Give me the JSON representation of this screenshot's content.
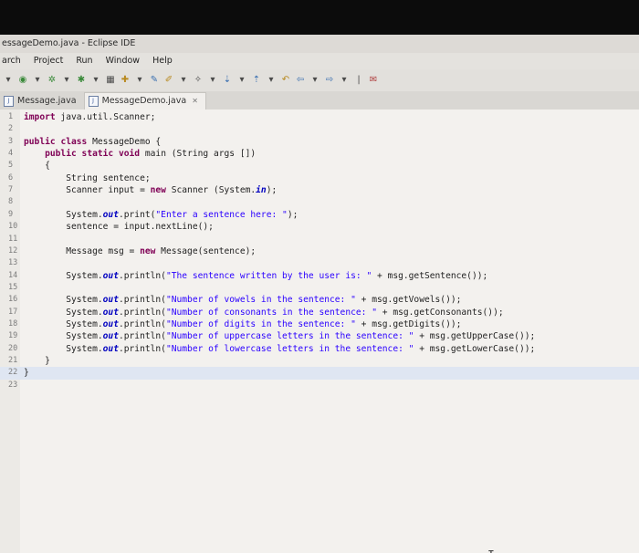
{
  "window": {
    "title": "essageDemo.java - Eclipse IDE"
  },
  "menu": {
    "items": [
      "arch",
      "Project",
      "Run",
      "Window",
      "Help"
    ]
  },
  "toolbar": {
    "icons": [
      "run-icon",
      "debug-icon",
      "coverage-icon",
      "new-icon",
      "save-icon",
      "search-icon",
      "back-icon",
      "forward-icon"
    ]
  },
  "tabs": [
    {
      "label": "Message.java",
      "active": false
    },
    {
      "label": "MessageDemo.java",
      "active": true,
      "close": "✕"
    }
  ],
  "editor": {
    "lines": [
      {
        "n": "1",
        "code": "import java.util.Scanner;"
      },
      {
        "n": "2",
        "code": ""
      },
      {
        "n": "3",
        "code": "public class MessageDemo {"
      },
      {
        "n": "4",
        "code": "    public static void main (String args [])"
      },
      {
        "n": "5",
        "code": "    {"
      },
      {
        "n": "6",
        "code": "        String sentence;"
      },
      {
        "n": "7",
        "code": "        Scanner input = new Scanner (System.in);"
      },
      {
        "n": "8",
        "code": ""
      },
      {
        "n": "9",
        "code": "        System.out.print(\"Enter a sentence here: \");"
      },
      {
        "n": "10",
        "code": "        sentence = input.nextLine();"
      },
      {
        "n": "11",
        "code": ""
      },
      {
        "n": "12",
        "code": "        Message msg = new Message(sentence);"
      },
      {
        "n": "13",
        "code": ""
      },
      {
        "n": "14",
        "code": "        System.out.println(\"The sentence written by the user is: \" + msg.getSentence());"
      },
      {
        "n": "15",
        "code": ""
      },
      {
        "n": "16",
        "code": "        System.out.println(\"Number of vowels in the sentence: \" + msg.getVowels());"
      },
      {
        "n": "17",
        "code": "        System.out.println(\"Number of consonants in the sentence: \" + msg.getConsonants());"
      },
      {
        "n": "18",
        "code": "        System.out.println(\"Number of digits in the sentence: \" + msg.getDigits());"
      },
      {
        "n": "19",
        "code": "        System.out.println(\"Number of uppercase letters in the sentence: \" + msg.getUpperCase());"
      },
      {
        "n": "20",
        "code": "        System.out.println(\"Number of lowercase letters in the sentence: \" + msg.getLowerCase());"
      },
      {
        "n": "21",
        "code": "    }"
      },
      {
        "n": "22",
        "code": "}"
      },
      {
        "n": "23",
        "code": ""
      }
    ],
    "current_line": "22"
  },
  "colors": {
    "keyword": "#7f0055",
    "string": "#2a00ff",
    "field": "#0000c0",
    "current_line": "#dfe6f2"
  }
}
